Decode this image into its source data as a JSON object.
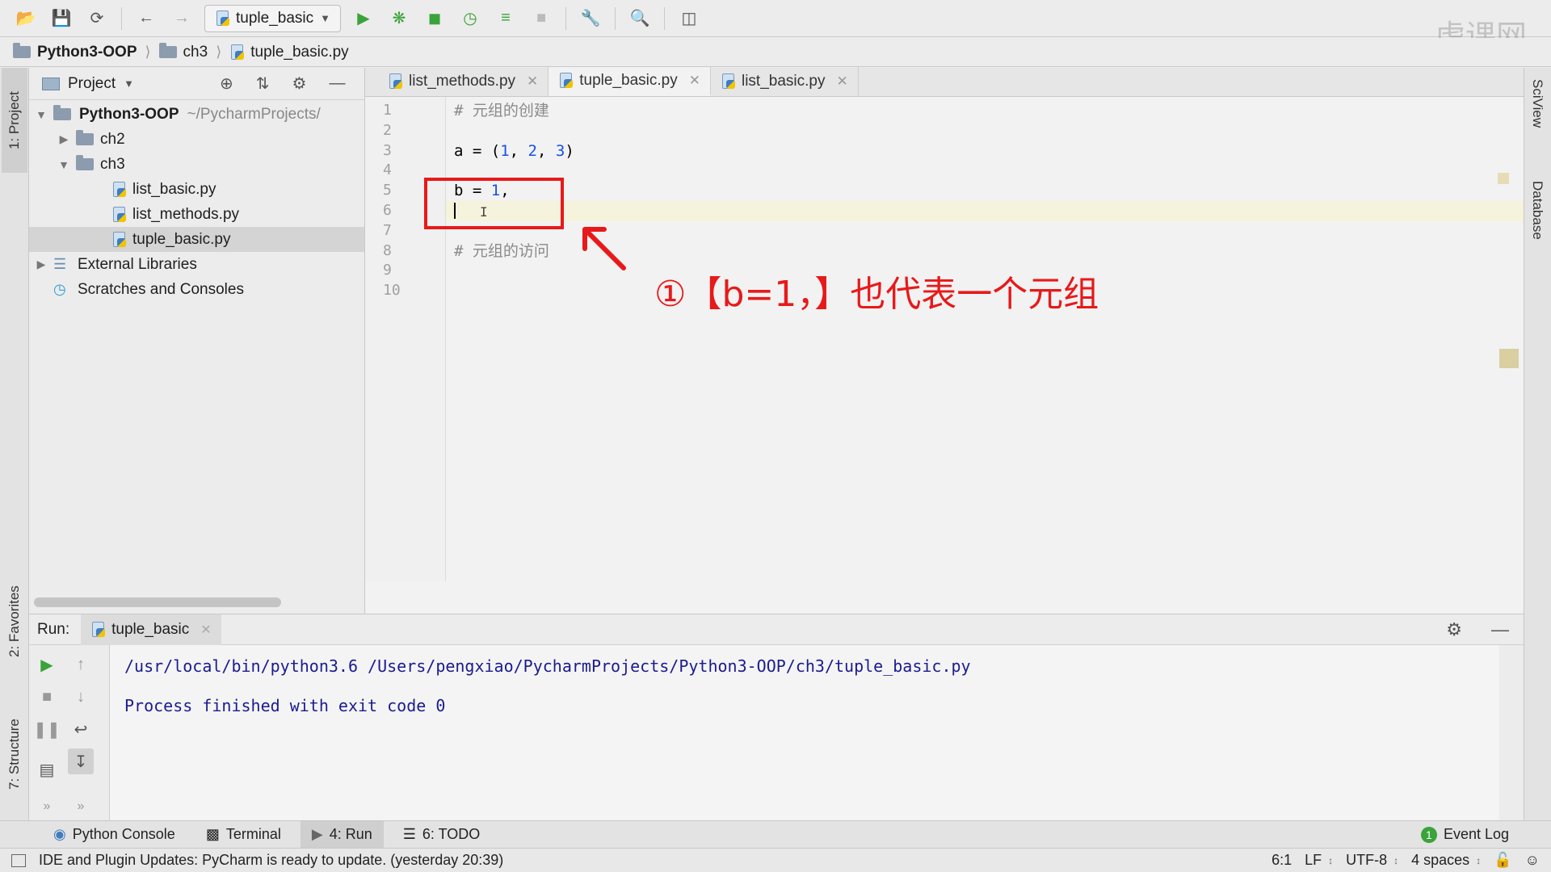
{
  "toolbar": {
    "run_config": "tuple_basic"
  },
  "breadcrumb": {
    "project": "Python3-OOP",
    "folder": "ch3",
    "file": "tuple_basic.py"
  },
  "left_strip": {
    "project_tab": "1: Project",
    "favorites_tab": "2: Favorites",
    "structure_tab": "7: Structure"
  },
  "right_strip": {
    "sciview_tab": "SciView",
    "database_tab": "Database"
  },
  "project_panel": {
    "title": "Project",
    "root": {
      "name": "Python3-OOP",
      "path": "~/PycharmProjects/"
    },
    "items": [
      {
        "name": "ch2"
      },
      {
        "name": "ch3"
      },
      {
        "name": "list_basic.py"
      },
      {
        "name": "list_methods.py"
      },
      {
        "name": "tuple_basic.py"
      },
      {
        "name": "External Libraries"
      },
      {
        "name": "Scratches and Consoles"
      }
    ]
  },
  "editor": {
    "tabs": [
      {
        "label": "list_methods.py"
      },
      {
        "label": "tuple_basic.py"
      },
      {
        "label": "list_basic.py"
      }
    ],
    "line_numbers": [
      "1",
      "2",
      "3",
      "4",
      "5",
      "6",
      "7",
      "8",
      "9",
      "10"
    ],
    "lines": {
      "l1": "# 元组的创建",
      "l3a": "a = (",
      "l3n1": "1",
      "l3c1": ", ",
      "l3n2": "2",
      "l3c2": ", ",
      "l3n3": "3",
      "l3e": ")",
      "l5a": "b = ",
      "l5n": "1",
      "l5e": ",",
      "l8": "# 元组的访问"
    }
  },
  "annotation": {
    "text": "①【b=1，】也代表一个元组",
    "color": "#e8191a"
  },
  "watermark": "虎课网",
  "run_panel": {
    "label": "Run:",
    "tab": "tuple_basic",
    "output": [
      "/usr/local/bin/python3.6 /Users/pengxiao/PycharmProjects/Python3-OOP/ch3/tuple_basic.py",
      "Process finished with exit code 0"
    ]
  },
  "bottom_tabs": {
    "python_console": "Python Console",
    "terminal": "Terminal",
    "run": "4: Run",
    "todo": "6: TODO",
    "event_log": "Event Log",
    "event_count": "1"
  },
  "status": {
    "message": "IDE and Plugin Updates: PyCharm is ready to update. (yesterday 20:39)",
    "position": "6:1",
    "line_sep": "LF",
    "encoding": "UTF-8",
    "indent": "4 spaces"
  }
}
